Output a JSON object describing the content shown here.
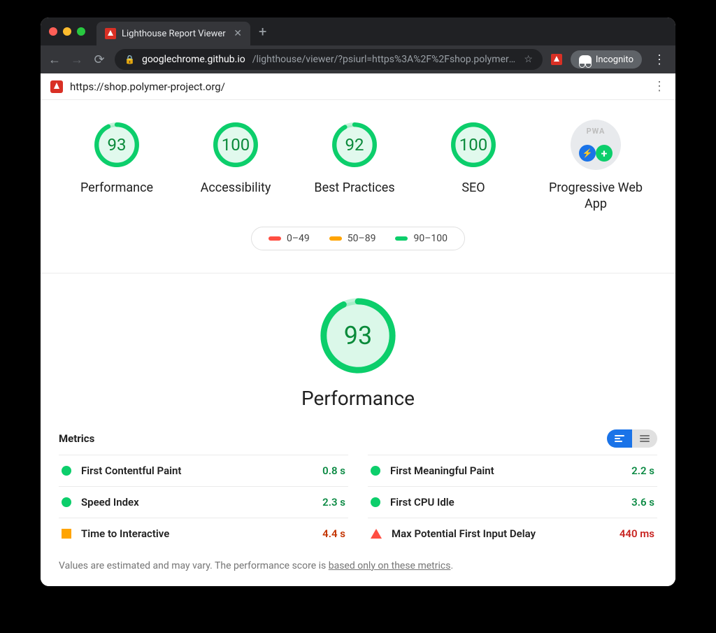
{
  "browser": {
    "tab_title": "Lighthouse Report Viewer",
    "url_host": "googlechrome.github.io",
    "url_path": "/lighthouse/viewer/?psiurl=https%3A%2F%2Fshop.polymer-…",
    "incognito_label": "Incognito"
  },
  "report": {
    "page_url": "https://shop.polymer-project.org/",
    "gauges": [
      {
        "label": "Performance",
        "score": "93",
        "color": "#0cce6b",
        "pct": 93
      },
      {
        "label": "Accessibility",
        "score": "100",
        "color": "#0cce6b",
        "pct": 100
      },
      {
        "label": "Best Practices",
        "score": "92",
        "color": "#0cce6b",
        "pct": 92
      },
      {
        "label": "SEO",
        "score": "100",
        "color": "#0cce6b",
        "pct": 100
      }
    ],
    "pwa_label": "Progressive Web App",
    "legend": {
      "fail": "0–49",
      "avg": "50–89",
      "pass": "90–100"
    },
    "big": {
      "score": "93",
      "label": "Performance",
      "color": "#0cce6b",
      "pct": 93
    },
    "metrics_title": "Metrics",
    "metrics": [
      {
        "name": "First Contentful Paint",
        "value": "0.8 s",
        "status": "pass"
      },
      {
        "name": "First Meaningful Paint",
        "value": "2.2 s",
        "status": "pass"
      },
      {
        "name": "Speed Index",
        "value": "2.3 s",
        "status": "pass"
      },
      {
        "name": "First CPU Idle",
        "value": "3.6 s",
        "status": "pass"
      },
      {
        "name": "Time to Interactive",
        "value": "4.4 s",
        "status": "avg"
      },
      {
        "name": "Max Potential First Input Delay",
        "value": "440 ms",
        "status": "fail"
      }
    ],
    "disclaimer_pre": "Values are estimated and may vary. The performance score is ",
    "disclaimer_link": "based only on these metrics",
    "disclaimer_post": "."
  }
}
